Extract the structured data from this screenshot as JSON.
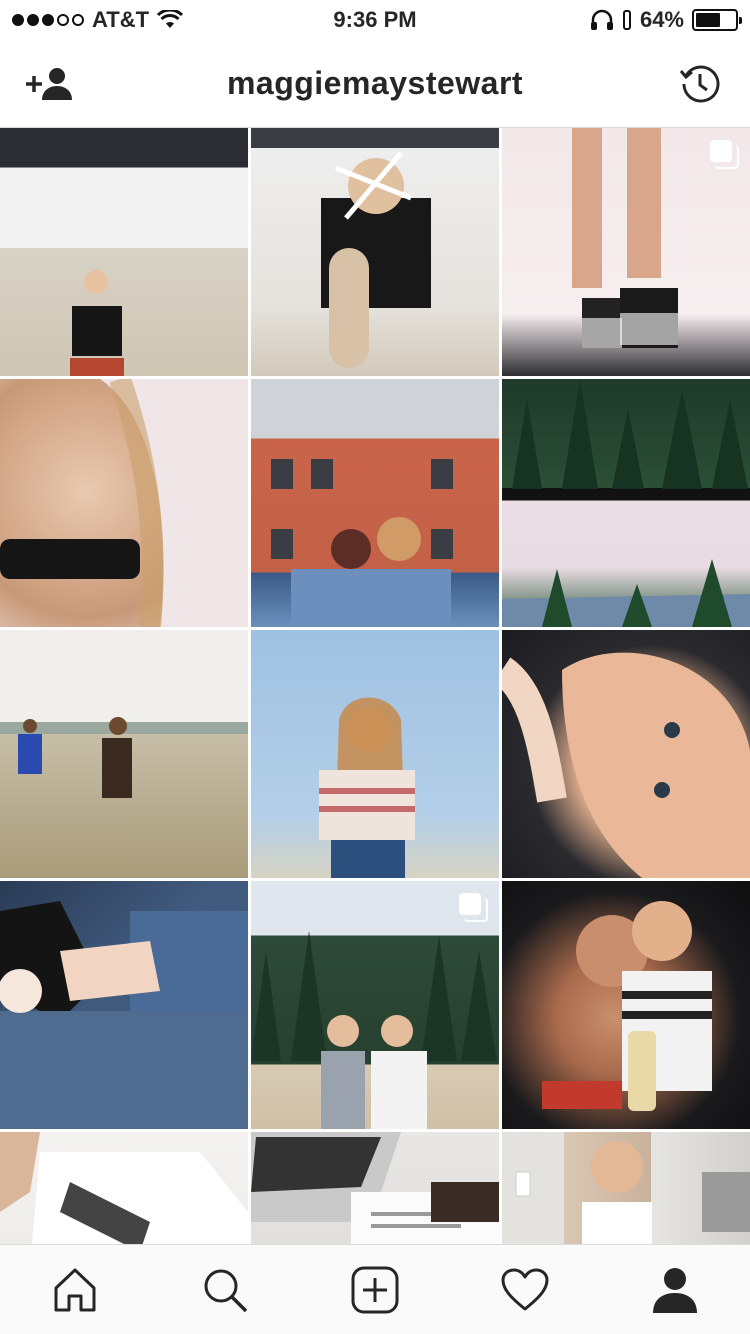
{
  "status_bar": {
    "carrier": "AT&T",
    "time": "9:36 PM",
    "battery_percent": "64%",
    "battery_level": 0.64,
    "signal_bars_filled": 3,
    "signal_bars_total": 5
  },
  "header": {
    "username": "maggiemaystewart",
    "left_icon": "add-person-icon",
    "right_icon": "history-icon"
  },
  "grid": {
    "tiles": [
      {
        "id": 1,
        "multi": false
      },
      {
        "id": 2,
        "multi": false
      },
      {
        "id": 3,
        "multi": true
      },
      {
        "id": 4,
        "multi": false
      },
      {
        "id": 5,
        "multi": false
      },
      {
        "id": 6,
        "multi": false
      },
      {
        "id": 7,
        "multi": false
      },
      {
        "id": 8,
        "multi": false
      },
      {
        "id": 9,
        "multi": false
      },
      {
        "id": 10,
        "multi": false
      },
      {
        "id": 11,
        "multi": true
      },
      {
        "id": 12,
        "multi": false
      },
      {
        "id": 13,
        "multi": false
      },
      {
        "id": 14,
        "multi": false
      },
      {
        "id": 15,
        "multi": false
      }
    ]
  },
  "tabbar": {
    "items": [
      {
        "icon": "home-icon"
      },
      {
        "icon": "search-icon"
      },
      {
        "icon": "add-post-icon"
      },
      {
        "icon": "heart-icon"
      },
      {
        "icon": "profile-icon",
        "active": true
      }
    ]
  }
}
